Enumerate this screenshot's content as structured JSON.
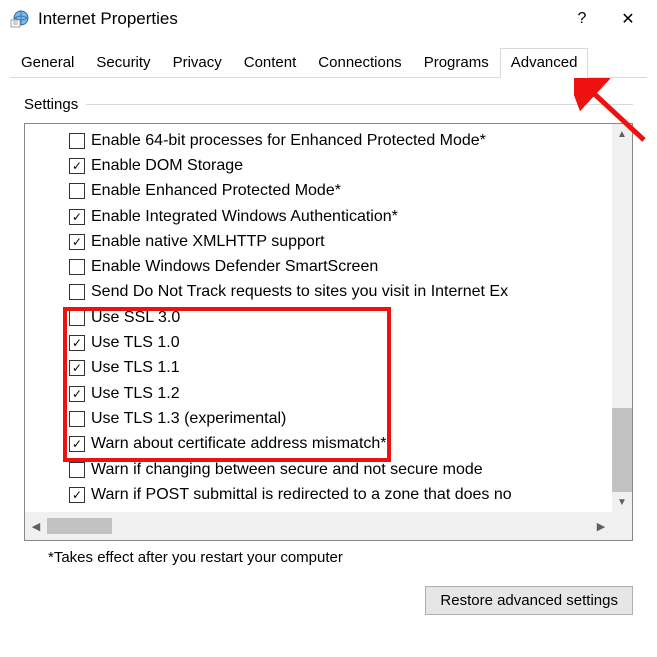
{
  "window": {
    "title": "Internet Properties",
    "help_symbol": "?",
    "close_symbol": "✕"
  },
  "tabs": {
    "items": [
      {
        "label": "General"
      },
      {
        "label": "Security"
      },
      {
        "label": "Privacy"
      },
      {
        "label": "Content"
      },
      {
        "label": "Connections"
      },
      {
        "label": "Programs"
      },
      {
        "label": "Advanced"
      }
    ],
    "active_index": 6
  },
  "fieldset": {
    "label": "Settings"
  },
  "settings": [
    {
      "checked": false,
      "label": "Enable 64-bit processes for Enhanced Protected Mode*"
    },
    {
      "checked": true,
      "label": "Enable DOM Storage"
    },
    {
      "checked": false,
      "label": "Enable Enhanced Protected Mode*"
    },
    {
      "checked": true,
      "label": "Enable Integrated Windows Authentication*"
    },
    {
      "checked": true,
      "label": "Enable native XMLHTTP support"
    },
    {
      "checked": false,
      "label": "Enable Windows Defender SmartScreen"
    },
    {
      "checked": false,
      "label": "Send Do Not Track requests to sites you visit in Internet Ex"
    },
    {
      "checked": false,
      "label": "Use SSL 3.0"
    },
    {
      "checked": true,
      "label": "Use TLS 1.0"
    },
    {
      "checked": true,
      "label": "Use TLS 1.1"
    },
    {
      "checked": true,
      "label": "Use TLS 1.2"
    },
    {
      "checked": false,
      "label": "Use TLS 1.3 (experimental)"
    },
    {
      "checked": true,
      "label": "Warn about certificate address mismatch*"
    },
    {
      "checked": false,
      "label": "Warn if changing between secure and not secure mode"
    },
    {
      "checked": true,
      "label": "Warn if POST submittal is redirected to a zone that does no"
    }
  ],
  "note": "*Takes effect after you restart your computer",
  "restore_button": "Restore advanced settings",
  "annotation": {
    "highlight_start_index": 7,
    "highlight_end_index": 11,
    "arrow_points_to": "tab-advanced",
    "highlight_color": "#e11"
  }
}
